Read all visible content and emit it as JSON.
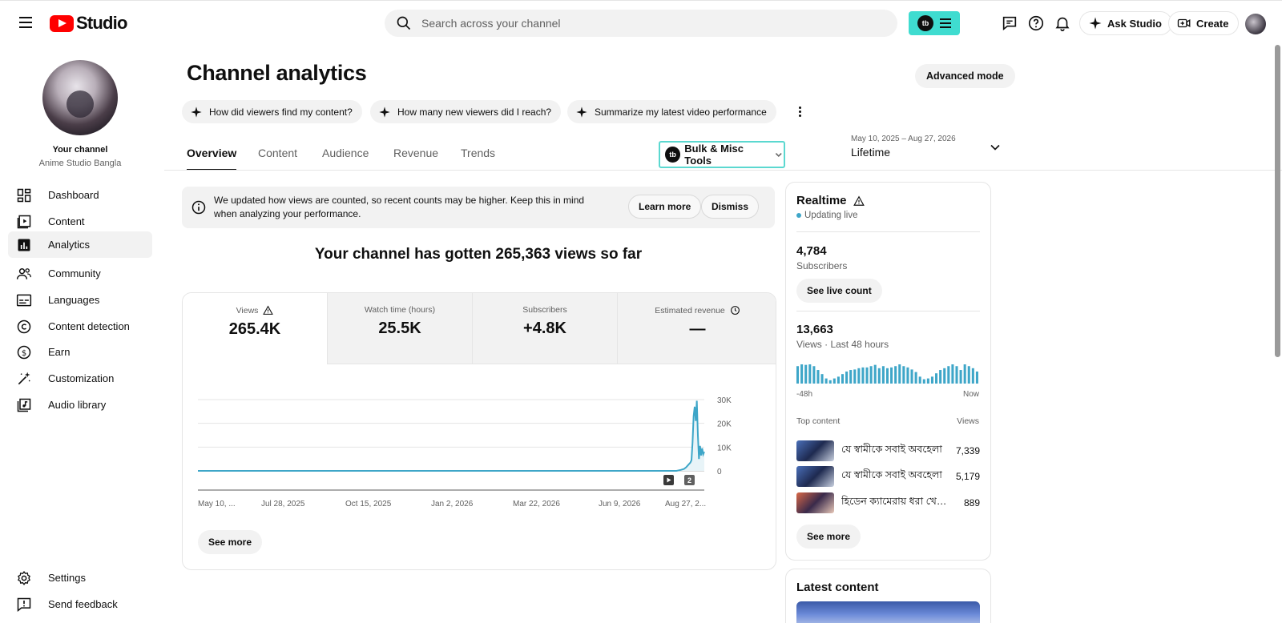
{
  "app": {
    "logo_text": "Studio",
    "brand_color": "#ff0000",
    "accent_color": "#3ea6c8"
  },
  "search": {
    "placeholder": "Search across your channel"
  },
  "extension": {
    "badge": "tb"
  },
  "topbar": {
    "ask_studio": "Ask Studio",
    "create": "Create"
  },
  "sidebar": {
    "your_channel": "Your channel",
    "channel_name": "Anime Studio Bangla",
    "items": [
      {
        "label": "Dashboard",
        "icon": "dashboard-icon"
      },
      {
        "label": "Content",
        "icon": "content-icon"
      },
      {
        "label": "Analytics",
        "icon": "analytics-icon"
      },
      {
        "label": "Community",
        "icon": "community-icon"
      },
      {
        "label": "Languages",
        "icon": "languages-icon"
      },
      {
        "label": "Content detection",
        "icon": "copyright-icon"
      },
      {
        "label": "Earn",
        "icon": "earn-icon"
      },
      {
        "label": "Customization",
        "icon": "customization-icon"
      },
      {
        "label": "Audio library",
        "icon": "audio-library-icon"
      }
    ],
    "settings": "Settings",
    "feedback": "Send feedback"
  },
  "page": {
    "title": "Channel analytics",
    "advanced_mode": "Advanced mode",
    "chips": [
      "How did viewers find my content?",
      "How many new viewers did I reach?",
      "Summarize my latest video performance"
    ],
    "tabs": [
      "Overview",
      "Content",
      "Audience",
      "Revenue",
      "Trends"
    ],
    "bulk_tools": "Bulk & Misc Tools",
    "bulk_badge": "tb",
    "date_range": "May 10, 2025 – Aug 27, 2026",
    "period": "Lifetime"
  },
  "notice": {
    "text": "We updated how views are counted, so recent counts may be higher. Keep this in mind when analyzing your performance.",
    "learn_more": "Learn more",
    "dismiss": "Dismiss"
  },
  "headline": "Your channel has gotten 265,363 views so far",
  "metrics": [
    {
      "label": "Views",
      "value": "265.4K"
    },
    {
      "label": "Watch time (hours)",
      "value": "25.5K"
    },
    {
      "label": "Subscribers",
      "value": "+4.8K"
    },
    {
      "label": "Estimated revenue",
      "value": "—"
    }
  ],
  "chart_data": {
    "type": "line",
    "y_ticks": [
      "30K",
      "20K",
      "10K",
      "0"
    ],
    "ylim": [
      0,
      30000
    ],
    "x_tick_labels": [
      "May 10, ...",
      "Jul 28, 2025",
      "Oct 15, 2025",
      "Jan 2, 2026",
      "Mar 22, 2026",
      "Jun 9, 2026",
      "Aug 27, 2..."
    ],
    "series": [
      {
        "x": [
          "2025-05-10",
          "2025-07-01",
          "2025-10-01",
          "2026-01-01",
          "2026-04-01",
          "2026-07-15",
          "2026-08-01",
          "2026-08-05",
          "2026-08-08",
          "2026-08-10",
          "2026-08-12",
          "2026-08-14",
          "2026-08-15",
          "2026-08-16",
          "2026-08-17",
          "2026-08-18",
          "2026-08-19",
          "2026-08-20",
          "2026-08-21",
          "2026-08-22",
          "2026-08-23",
          "2026-08-24",
          "2026-08-25",
          "2026-08-26",
          "2026-08-27"
        ],
        "values": [
          0,
          0,
          0,
          0,
          0,
          0,
          0,
          400,
          800,
          1500,
          2500,
          3500,
          4500,
          12000,
          23000,
          27000,
          21000,
          29500,
          15000,
          5000,
          10500,
          6500,
          9500,
          7000,
          8000
        ]
      }
    ],
    "markers": [
      "video-marker",
      "2"
    ],
    "line_color": "#3ea6c8"
  },
  "metrics_see_more": "See more",
  "realtime": {
    "title": "Realtime",
    "status": "Updating live",
    "subscribers_value": "4,784",
    "subscribers_label": "Subscribers",
    "see_live_count": "See live count",
    "views_value": "13,663",
    "views_label": "Views · Last 48 hours",
    "bars": [
      0.68,
      0.75,
      0.73,
      0.75,
      0.68,
      0.53,
      0.37,
      0.2,
      0.13,
      0.2,
      0.27,
      0.37,
      0.47,
      0.53,
      0.55,
      0.6,
      0.63,
      0.63,
      0.68,
      0.73,
      0.6,
      0.68,
      0.6,
      0.63,
      0.68,
      0.75,
      0.68,
      0.63,
      0.55,
      0.45,
      0.27,
      0.17,
      0.2,
      0.27,
      0.4,
      0.53,
      0.6,
      0.68,
      0.75,
      0.68,
      0.53,
      0.75,
      0.68,
      0.6,
      0.47
    ],
    "axis_start": "-48h",
    "axis_end": "Now",
    "top_content_label": "Top content",
    "views_col_label": "Views",
    "top_content": [
      {
        "title": "যে স্বামীকে সবাই অবহেলা",
        "views": "7,339"
      },
      {
        "title": "যে স্বামীকে সবাই অবহেলা",
        "views": "5,179"
      },
      {
        "title": "হিডেন ক্যামেরায় ধরা খেলো",
        "views": "889"
      }
    ],
    "see_more": "See more"
  },
  "latest_content": {
    "title": "Latest content"
  }
}
